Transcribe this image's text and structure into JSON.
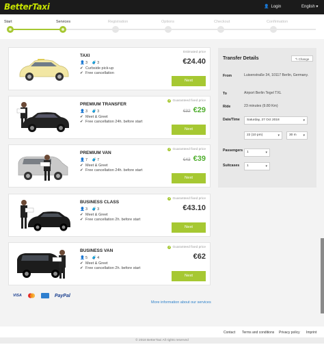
{
  "brand": {
    "logo": "BetterTaxi",
    "accent": "#a6c832",
    "price_green": "#4fae2e"
  },
  "header": {
    "login": "Login",
    "language": "English"
  },
  "steps": {
    "labels": [
      "Start",
      "Services",
      "Registration",
      "Options",
      "Checkout",
      "Confirmation"
    ],
    "current_index": 1
  },
  "cards": [
    {
      "title": "TAXI",
      "passengers": "3",
      "luggage": "3",
      "lines": [
        "Curbside pick-up",
        "Free cancellation"
      ],
      "price_label": "Estimated price",
      "old_price": "",
      "price": "€24.40",
      "next": "Next",
      "image_icon": "taxi-car-icon"
    },
    {
      "title": "PREMIUM TRANSFER",
      "passengers": "3",
      "luggage": "3",
      "lines": [
        "Meet & Greet",
        "Free cancellation 24h. before start"
      ],
      "price_label": "Guaranteed fixed price",
      "old_price": "€32",
      "price": "€29",
      "next": "Next",
      "image_icon": "sedan-driver-icon"
    },
    {
      "title": "PREMIUM VAN",
      "passengers": "7",
      "luggage": "7",
      "lines": [
        "Meet & Greet",
        "Free cancellation 24h. before start"
      ],
      "price_label": "Guaranteed fixed price",
      "old_price": "€43",
      "price": "€39",
      "next": "Next",
      "image_icon": "van-driver-icon"
    },
    {
      "title": "BUSINESS CLASS",
      "passengers": "3",
      "luggage": "3",
      "lines": [
        "Meet & Greet",
        "Free cancellation 2h. before start"
      ],
      "price_label": "Guaranteed fixed price",
      "old_price": "",
      "price": "€43.10",
      "next": "Next",
      "image_icon": "business-sedan-icon"
    },
    {
      "title": "BUSINESS VAN",
      "passengers": "5",
      "luggage": "4",
      "lines": [
        "Meet & Greet",
        "Free cancellation 2h. before start"
      ],
      "price_label": "Guaranteed fixed price",
      "old_price": "",
      "price": "€62",
      "next": "Next",
      "image_icon": "business-van-icon"
    }
  ],
  "payments": [
    "VISA",
    "mastercard-icon",
    "amex-icon",
    "PayPal"
  ],
  "more_info": "More information about our services",
  "details": {
    "title": "Transfer Details",
    "change": "Change",
    "from_label": "From",
    "from_value": "Luisenstraße 34, 10117 Berlin, Germany.",
    "to_label": "To",
    "to_value": "Airport Berlin Tegel TXL",
    "ride_label": "Ride",
    "ride_value": "23 minutes (9.80 Km)",
    "datetime_label": "Date/Time",
    "date_value": "Saturday, 27 Oct 2018",
    "hour_value": "22 (10 pm)",
    "minute_value": "30 m",
    "passengers_label": "Passengers",
    "passengers_value": "1",
    "suitcases_label": "Suitcases",
    "suitcases_value": "1"
  },
  "footer": {
    "links": [
      "Contact",
      "Terms and conditions",
      "Privacy policy",
      "Imprint"
    ],
    "copyright": "© 2018 BetterTaxi All rights reserved"
  }
}
